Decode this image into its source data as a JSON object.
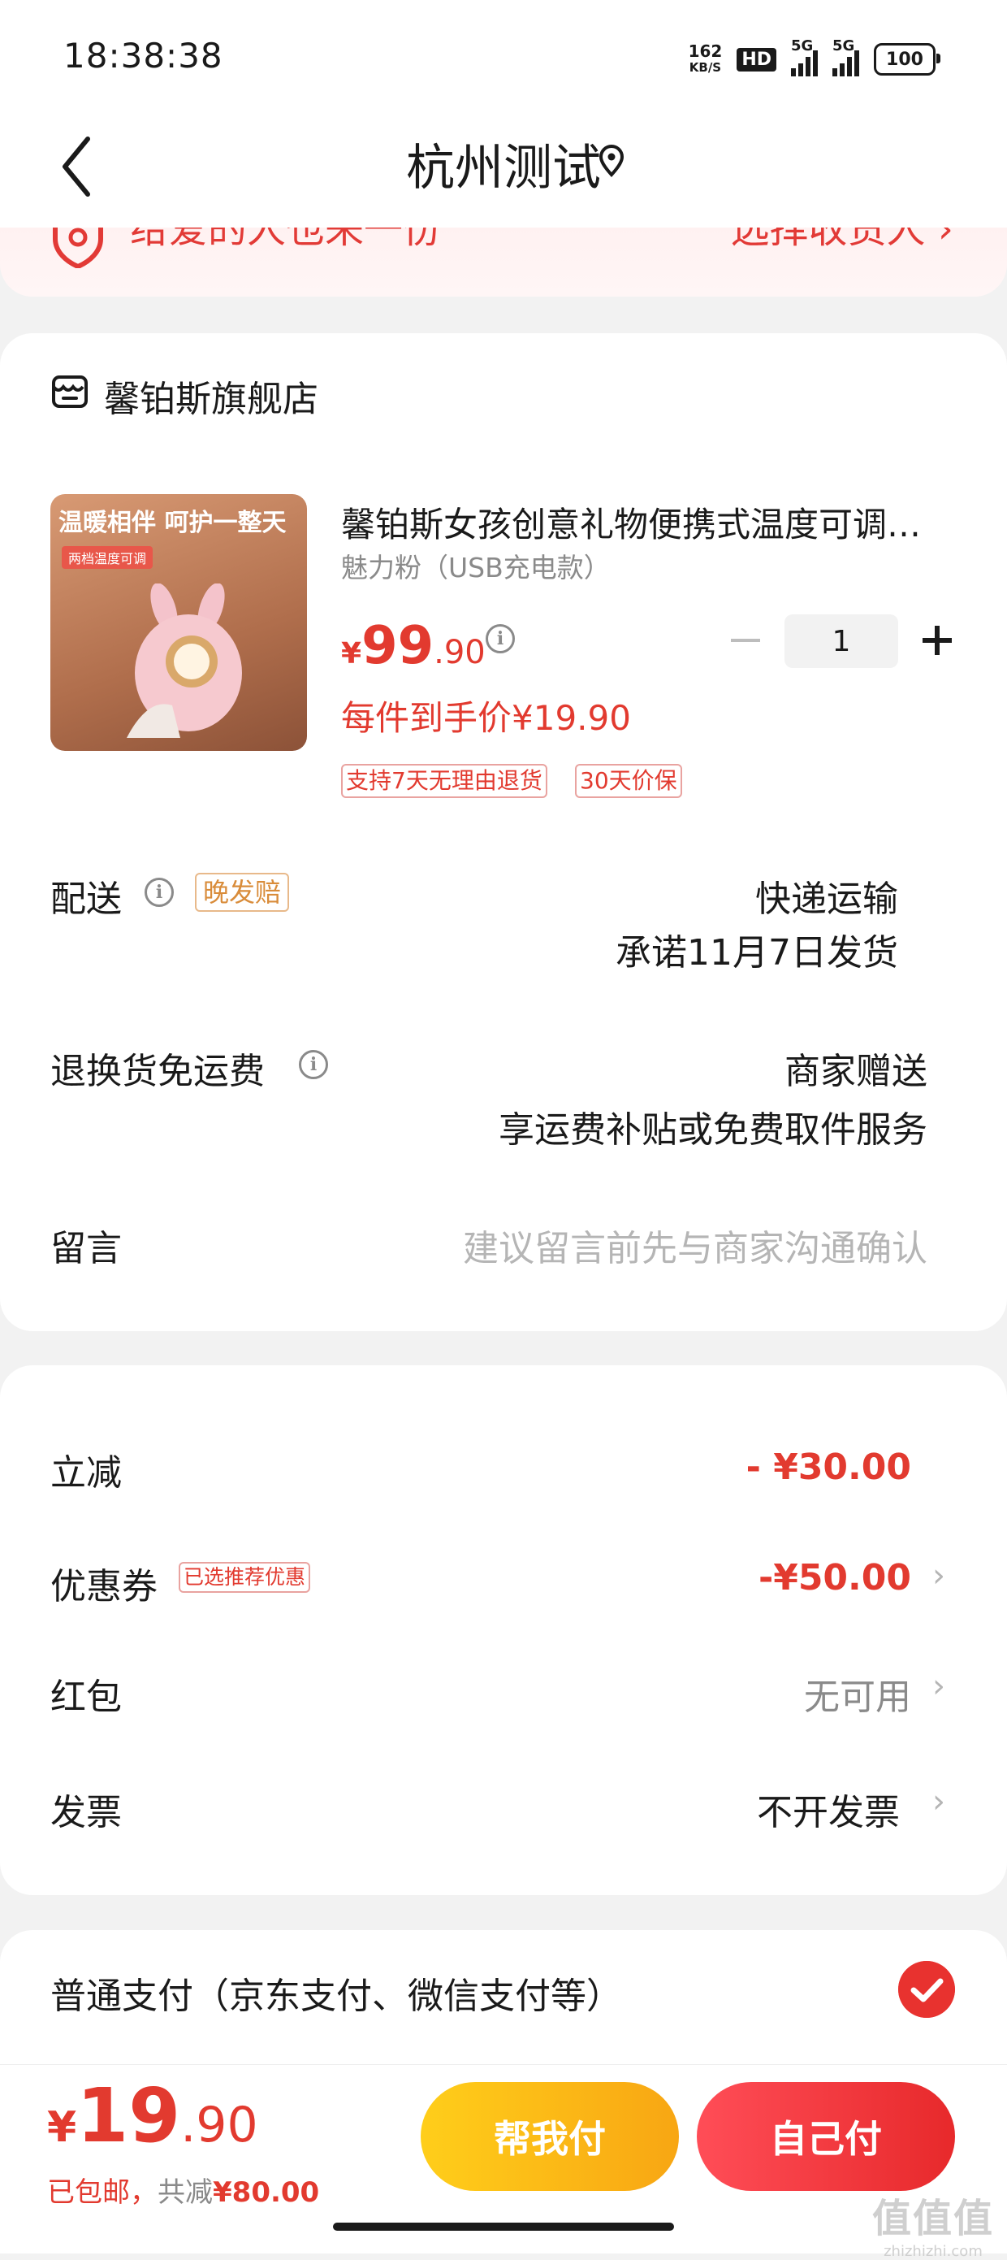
{
  "status_bar": {
    "time": "18:38:38",
    "net_speed_value": "162",
    "net_speed_unit": "KB/S",
    "hd_label": "HD",
    "signal1_label": "5G",
    "signal2_label": "5G",
    "battery": "100"
  },
  "header": {
    "title": "杭州测试",
    "back_icon": "chevron-left-icon",
    "location_icon": "location-pin-icon"
  },
  "gift_banner": {
    "text": "给爱的人也来一份",
    "link": "选择收货人 ›"
  },
  "shop": {
    "name": "馨铂斯旗舰店",
    "icon": "store-icon"
  },
  "product": {
    "image_header": "温暖相伴 呵护一整天",
    "image_tag": "两档温度可调",
    "title": "馨铂斯女孩创意礼物便携式温度可调暖手宝",
    "spec": "魅力粉（USB充电款）",
    "price_currency": "¥",
    "price_integer": "99",
    "price_decimal": ".90",
    "quantity": "1",
    "each_price": "每件到手价¥19.90",
    "tags": [
      "支持7天无理由退货",
      "30天价保"
    ]
  },
  "delivery": {
    "label": "配送",
    "late_tag": "晚发赔",
    "method": "快递运输",
    "promise": "承诺11月7日发货"
  },
  "return_shipping": {
    "label": "退换货免运费",
    "value": "商家赠送",
    "desc": "享运费补贴或免费取件服务"
  },
  "message": {
    "label": "留言",
    "placeholder": "建议留言前先与商家沟通确认"
  },
  "discounts": {
    "instant": {
      "label": "立减",
      "value": "- ¥30.00"
    },
    "coupon": {
      "label": "优惠券",
      "tag": "已选推荐优惠",
      "value": "-¥50.00"
    },
    "red_packet": {
      "label": "红包",
      "value": "无可用"
    },
    "invoice": {
      "label": "发票",
      "value": "不开发票"
    }
  },
  "payment": {
    "method": "普通支付（京东支付、微信支付等）"
  },
  "bottom_bar": {
    "total_currency": "¥",
    "total_integer": "19",
    "total_decimal": ".90",
    "free_shipping": "已包邮，",
    "saved_label": "共减",
    "saved_value": "¥80.00",
    "help_pay": "帮我付",
    "self_pay": "自己付"
  },
  "watermark": {
    "text": "值值值",
    "domain": "zhizhizhi.com"
  },
  "colors": {
    "accent_red": "#e23a2f",
    "pay_yellow": "#fbbd16",
    "pay_red": "#ef3236"
  }
}
